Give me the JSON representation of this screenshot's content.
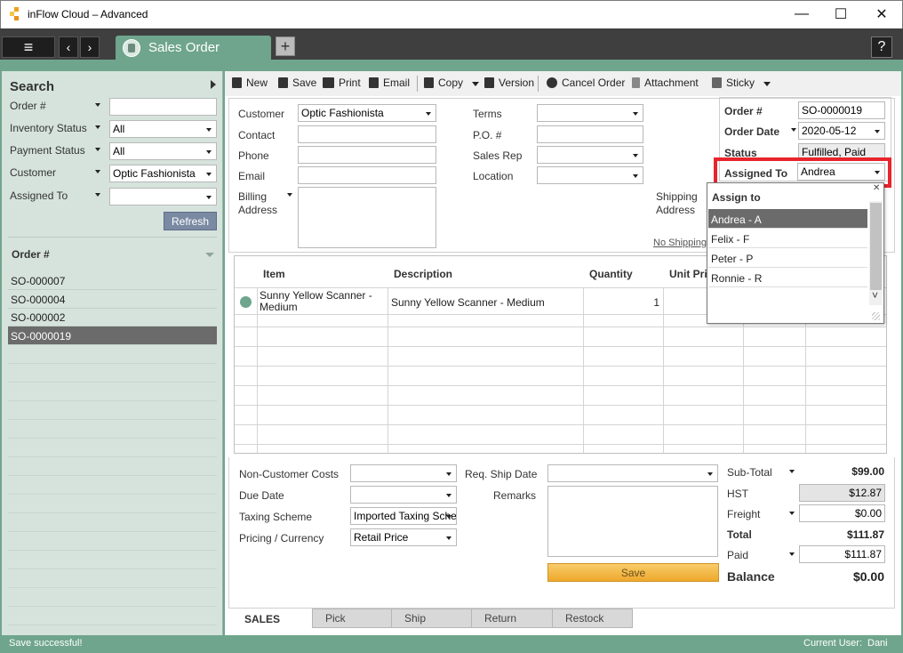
{
  "app": {
    "title": "inFlow Cloud – Advanced"
  },
  "window_controls": {
    "minimize": "—",
    "maximize": "☐",
    "close": "✕"
  },
  "tabbar": {
    "menu_icon": "≡",
    "back_icon": "‹",
    "forward_icon": "›",
    "doc_tab": "Sales Order",
    "add_tab": "+",
    "help": "?"
  },
  "search": {
    "title": "Search",
    "fields": [
      {
        "label": "Order #",
        "value": ""
      },
      {
        "label": "Inventory Status",
        "value": "All"
      },
      {
        "label": "Payment Status",
        "value": "All"
      },
      {
        "label": "Customer",
        "value": "Optic Fashionista"
      },
      {
        "label": "Assigned To",
        "value": ""
      }
    ],
    "refresh": "Refresh"
  },
  "order_list": {
    "header": "Order #",
    "rows": [
      "SO-000007",
      "SO-000004",
      "SO-000002",
      "SO-0000019"
    ],
    "selected_index": 3
  },
  "toolbar": {
    "new": "New",
    "save": "Save",
    "print": "Print",
    "email": "Email",
    "copy": "Copy",
    "version": "Version",
    "cancel_order": "Cancel Order",
    "attachment": "Attachment",
    "sticky": "Sticky"
  },
  "form": {
    "customer_label": "Customer",
    "customer_value": "Optic Fashionista",
    "contact_label": "Contact",
    "phone_label": "Phone",
    "email_label": "Email",
    "billing_label": "Billing",
    "address_label": "Address",
    "terms_label": "Terms",
    "po_label": "P.O. #",
    "sales_rep_label": "Sales Rep",
    "location_label": "Location",
    "shipping_label": "Shipping",
    "shipping_address_label": "Address",
    "no_shipping": "No Shipping"
  },
  "details": {
    "order_no_label": "Order #",
    "order_no": "SO-0000019",
    "order_date_label": "Order Date",
    "order_date": "2020-05-12",
    "status_label": "Status",
    "status": "Fulfilled, Paid",
    "assigned_label": "Assigned To",
    "assigned": "Andrea"
  },
  "assign_popup": {
    "title": "Assign to",
    "items": [
      "Andrea - A",
      "Felix - F",
      "Peter - P",
      "Ronnie - R"
    ],
    "selected_index": 0,
    "close": "✕",
    "scroll_down": "˅"
  },
  "grid": {
    "columns": [
      "Item",
      "Description",
      "Quantity",
      "Unit Pri"
    ],
    "rows": [
      {
        "item_line1": "Sunny Yellow Scanner -",
        "item_line2": "Medium",
        "description": "Sunny Yellow Scanner - Medium",
        "quantity": "1"
      }
    ]
  },
  "bottom": {
    "non_customer_costs": "Non-Customer Costs",
    "due_date": "Due Date",
    "taxing_scheme": "Taxing Scheme",
    "taxing_scheme_value": "Imported Taxing Sche",
    "pricing_currency": "Pricing / Currency",
    "pricing_value": "Retail Price",
    "req_ship_date": "Req. Ship Date",
    "remarks": "Remarks",
    "save": "Save"
  },
  "totals": {
    "subtotal_label": "Sub-Total",
    "subtotal": "$99.00",
    "hst_label": "HST",
    "hst": "$12.87",
    "freight_label": "Freight",
    "freight": "$0.00",
    "total_label": "Total",
    "total": "$111.87",
    "paid_label": "Paid",
    "paid": "$111.87",
    "balance_label": "Balance",
    "balance": "$0.00"
  },
  "bottom_tabs": [
    "SALES",
    "Pick",
    "Ship",
    "Return",
    "Restock"
  ],
  "status": {
    "message": "Save successful!",
    "user_label": "Current User:",
    "user": "Dani"
  },
  "colors": {
    "accent_green": "#6fa58c",
    "highlight_red": "#e8242c",
    "selected_row": "#6b6b6b",
    "save_gold": "#f3b53a"
  }
}
